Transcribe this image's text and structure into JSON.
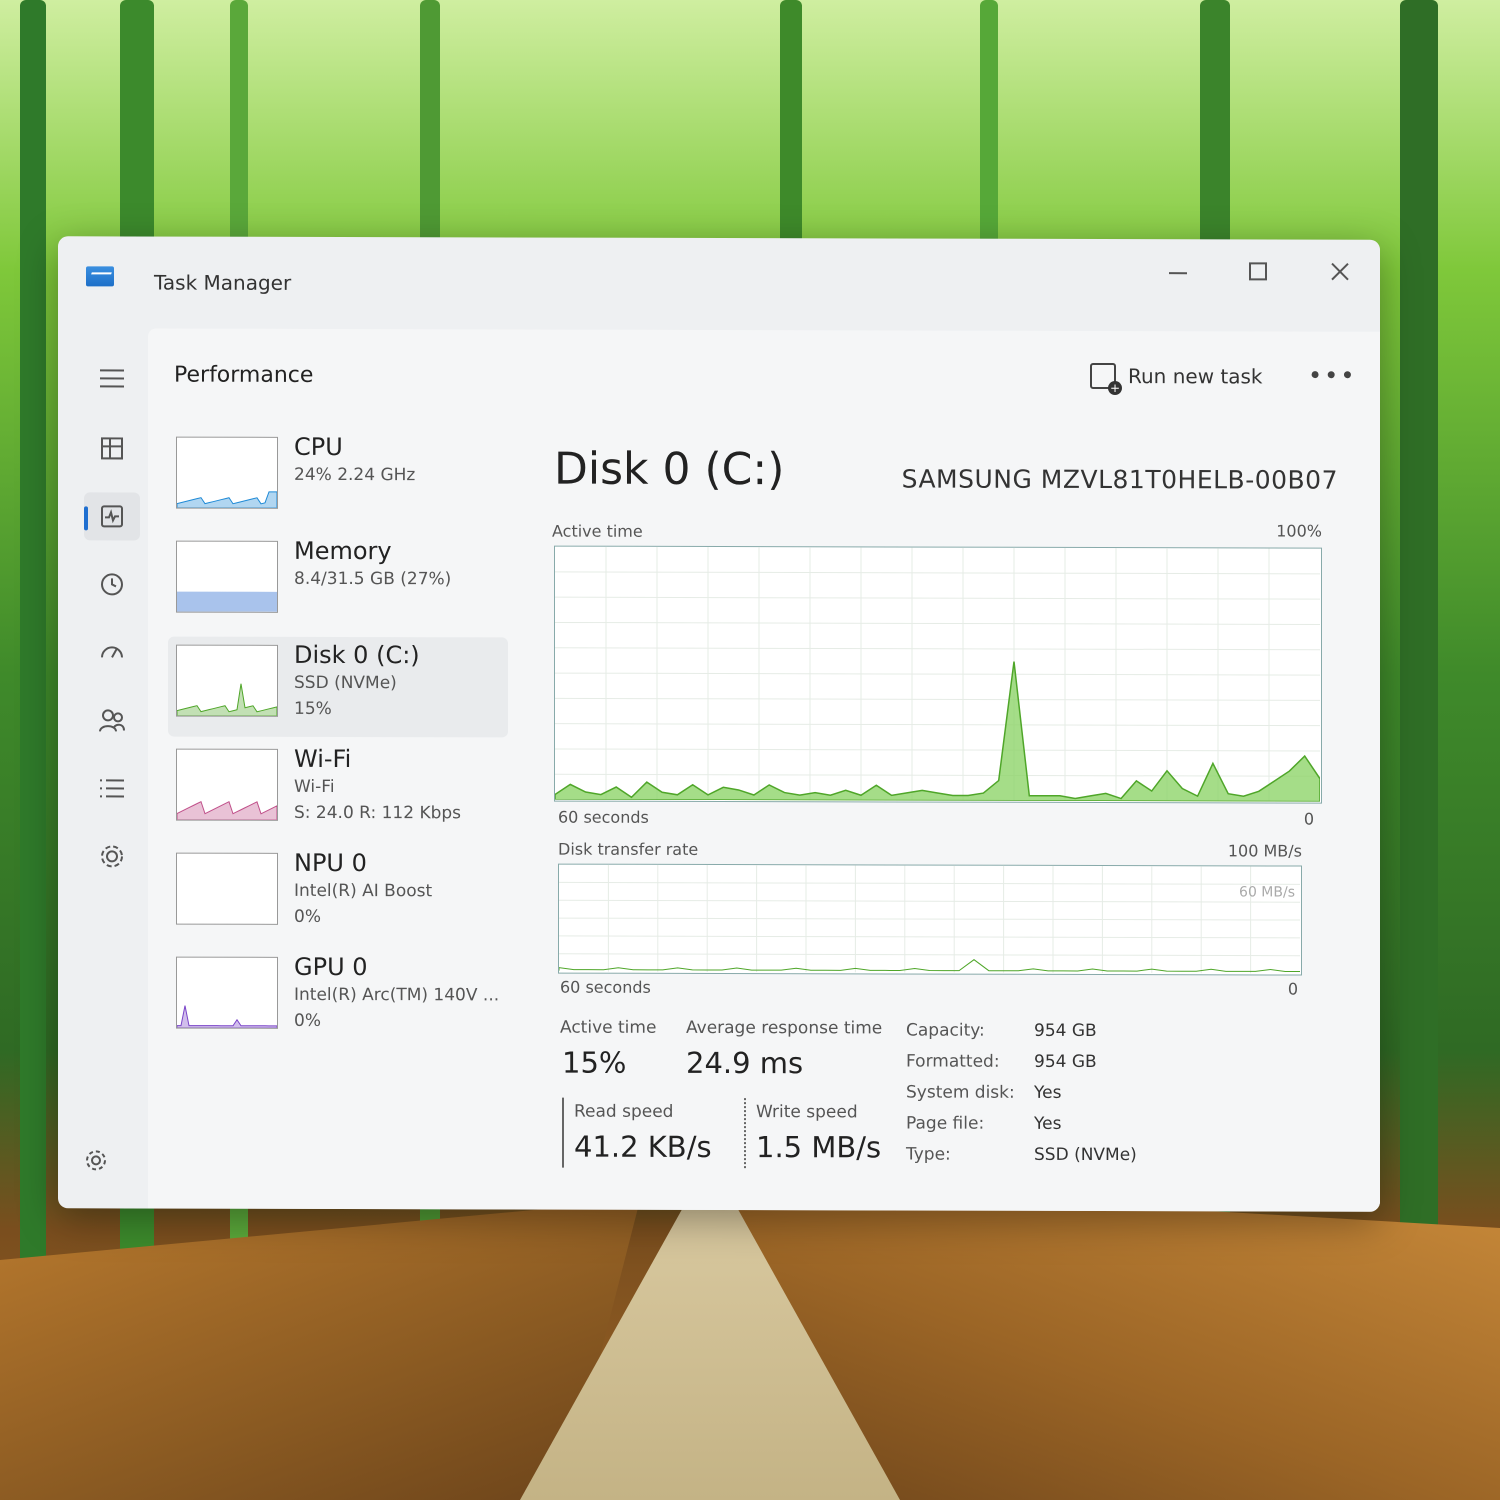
{
  "window": {
    "title": "Task Manager"
  },
  "toolbar": {
    "page_title": "Performance",
    "run_new_task": "Run new task"
  },
  "nav": [
    {
      "icon": "hamburger-menu-icon"
    },
    {
      "icon": "processes-icon"
    },
    {
      "icon": "performance-icon"
    },
    {
      "icon": "app-history-icon"
    },
    {
      "icon": "startup-apps-icon"
    },
    {
      "icon": "users-icon"
    },
    {
      "icon": "details-icon"
    },
    {
      "icon": "services-icon"
    }
  ],
  "perf_items": [
    {
      "name": "CPU",
      "line1": "24%  2.24 GHz",
      "line2": "",
      "color": "#1f8ad6"
    },
    {
      "name": "Memory",
      "line1": "8.4/31.5 GB (27%)",
      "line2": "",
      "color": "#6f9be0"
    },
    {
      "name": "Disk 0 (C:)",
      "line1": "SSD (NVMe)",
      "line2": "15%",
      "color": "#4fa629"
    },
    {
      "name": "Wi-Fi",
      "line1": "Wi-Fi",
      "line2": "S: 24.0  R: 112 Kbps",
      "color": "#c0508a"
    },
    {
      "name": "NPU 0",
      "line1": "Intel(R) AI Boost",
      "line2": "0%",
      "color": "#2aa0a0"
    },
    {
      "name": "GPU 0",
      "line1": "Intel(R) Arc(TM) 140V ...",
      "line2": "0%",
      "color": "#7a45c8"
    }
  ],
  "disk": {
    "title": "Disk 0 (C:)",
    "model": "SAMSUNG MZVL81T0HELB-00B07",
    "active_time_label": "Active time",
    "active_time_max": "100%",
    "axis_left": "60 seconds",
    "axis_right": "0",
    "transfer_label": "Disk transfer rate",
    "transfer_max": "100 MB/s",
    "transfer_mid": "60 MB/s",
    "stats": {
      "active_time_label": "Active time",
      "active_time": "15%",
      "avg_response_label": "Average response time",
      "avg_response": "24.9 ms",
      "read_label": "Read speed",
      "read": "41.2 KB/s",
      "write_label": "Write speed",
      "write": "1.5 MB/s"
    },
    "props": [
      {
        "k": "Capacity:",
        "v": "954 GB"
      },
      {
        "k": "Formatted:",
        "v": "954 GB"
      },
      {
        "k": "System disk:",
        "v": "Yes"
      },
      {
        "k": "Page file:",
        "v": "Yes"
      },
      {
        "k": "Type:",
        "v": "SSD (NVMe)"
      }
    ],
    "active_series": [
      2,
      6,
      3,
      2,
      5,
      1,
      7,
      3,
      2,
      6,
      2,
      5,
      4,
      2,
      6,
      3,
      2,
      3,
      2,
      4,
      2,
      6,
      2,
      3,
      4,
      3,
      2,
      2,
      3,
      8,
      55,
      2,
      2,
      2,
      1,
      2,
      3,
      1,
      8,
      4,
      12,
      5,
      2,
      15,
      3,
      2,
      4,
      8,
      12,
      18,
      9
    ]
  },
  "colors": {
    "disk_green": "#8fd46a",
    "disk_line": "#4fa629",
    "accent": "#1f6fd0"
  }
}
